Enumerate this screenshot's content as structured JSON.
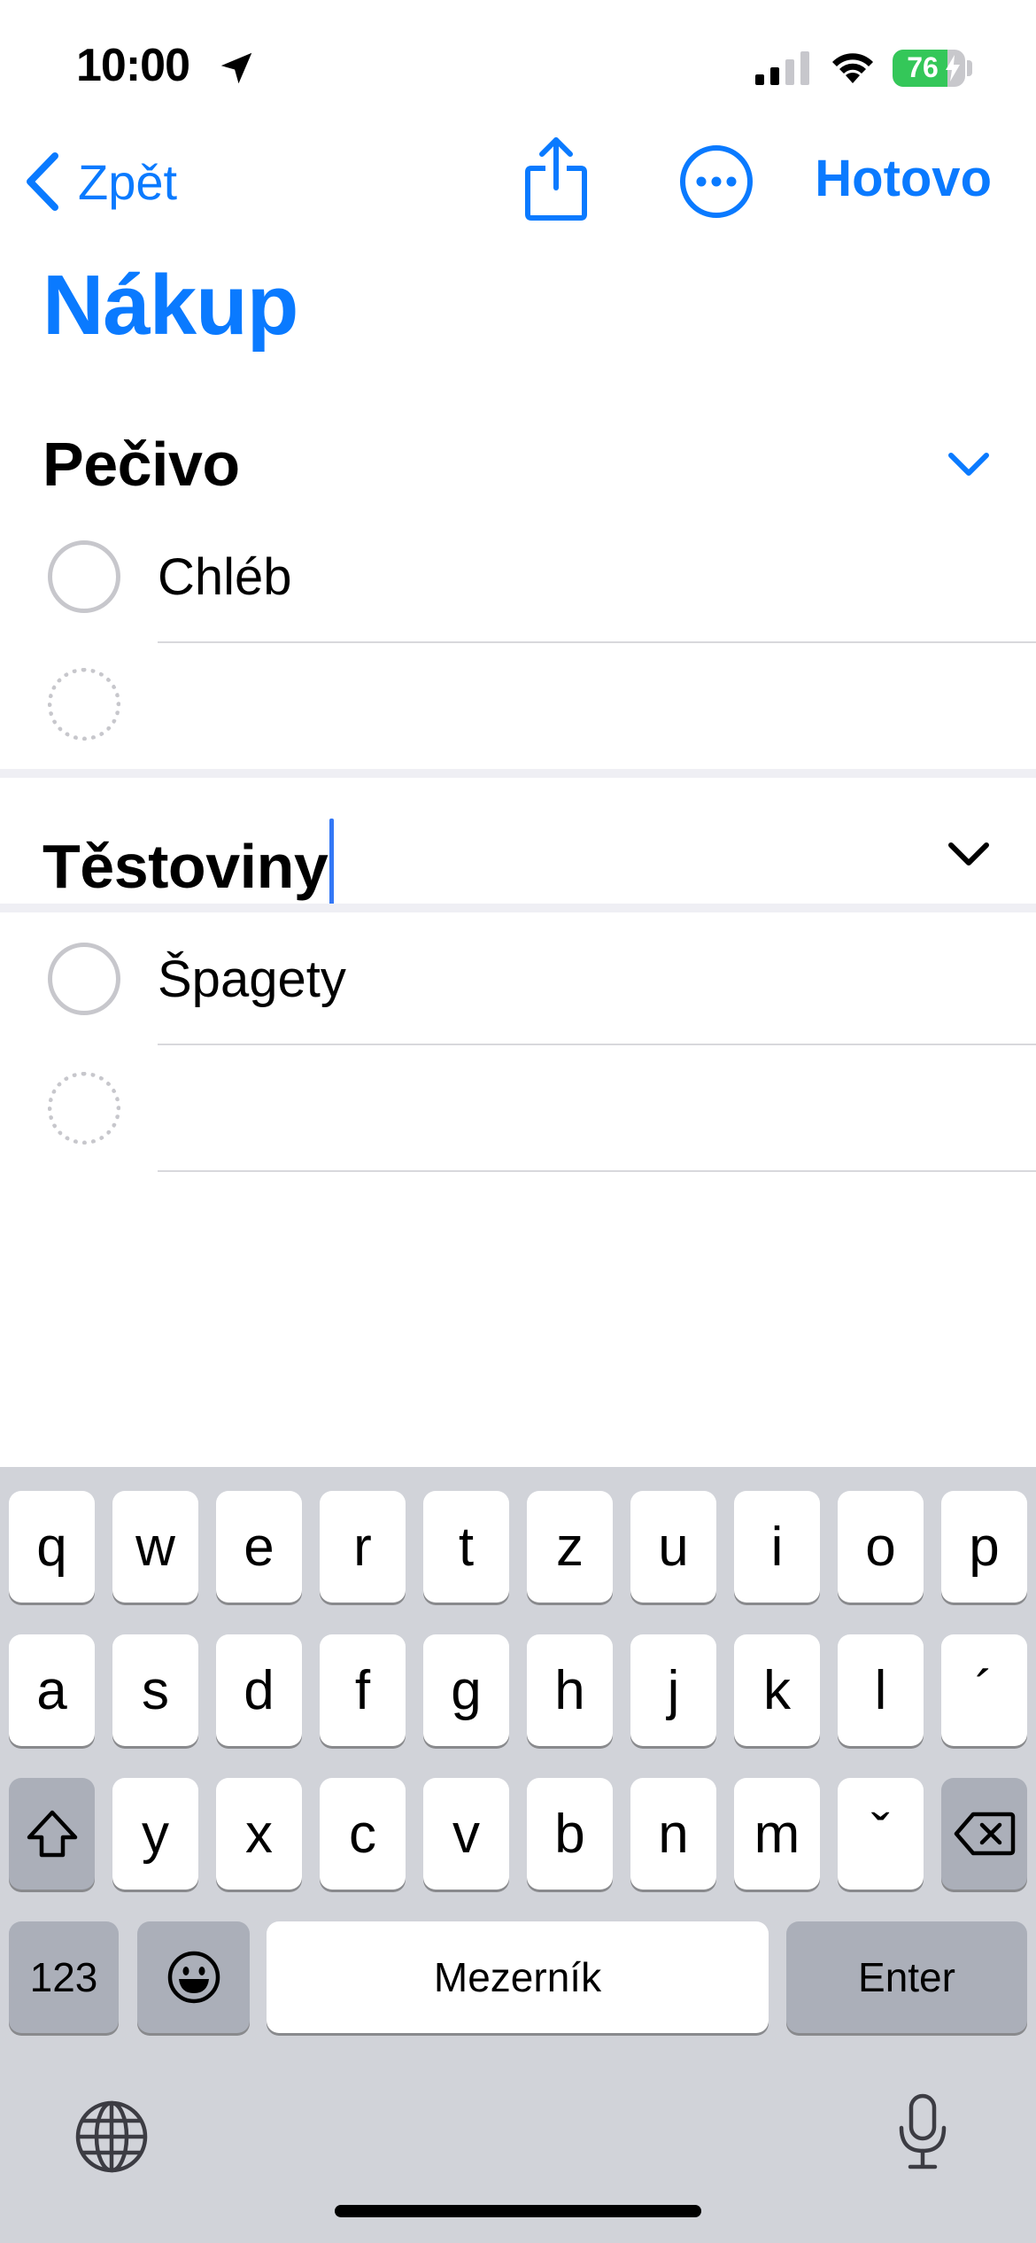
{
  "status_bar": {
    "time": "10:00",
    "battery_percent": "76",
    "battery_level": 0.76,
    "icons": [
      "location-arrow-icon",
      "cellular-signal-icon",
      "wifi-icon",
      "battery-icon",
      "charging-bolt-icon"
    ]
  },
  "nav": {
    "back_label": "Zpět",
    "share_icon": "share-icon",
    "more_icon": "ellipsis-circle-icon",
    "done_label": "Hotovo"
  },
  "list": {
    "title": "Nákup",
    "accent_color": "#0a7aff"
  },
  "sections": [
    {
      "title": "Pečivo",
      "chevron_color": "#0a7aff",
      "items": [
        {
          "text": "Chléb"
        }
      ],
      "new_item_placeholder": ""
    },
    {
      "title": "Těstoviny",
      "editing": true,
      "chevron_color": "#000000",
      "items": [
        {
          "text": "Špagety"
        }
      ],
      "new_item_placeholder": ""
    }
  ],
  "keyboard": {
    "row1": [
      "q",
      "w",
      "e",
      "r",
      "t",
      "z",
      "u",
      "i",
      "o",
      "p"
    ],
    "row2": [
      "a",
      "s",
      "d",
      "f",
      "g",
      "h",
      "j",
      "k",
      "l",
      "´"
    ],
    "row3": [
      "y",
      "x",
      "c",
      "v",
      "b",
      "n",
      "m",
      "ˇ"
    ],
    "numbers_label": "123",
    "space_label": "Mezerník",
    "enter_label": "Enter",
    "icons": [
      "shift-icon",
      "backspace-icon",
      "emoji-icon",
      "globe-icon",
      "microphone-icon"
    ]
  }
}
